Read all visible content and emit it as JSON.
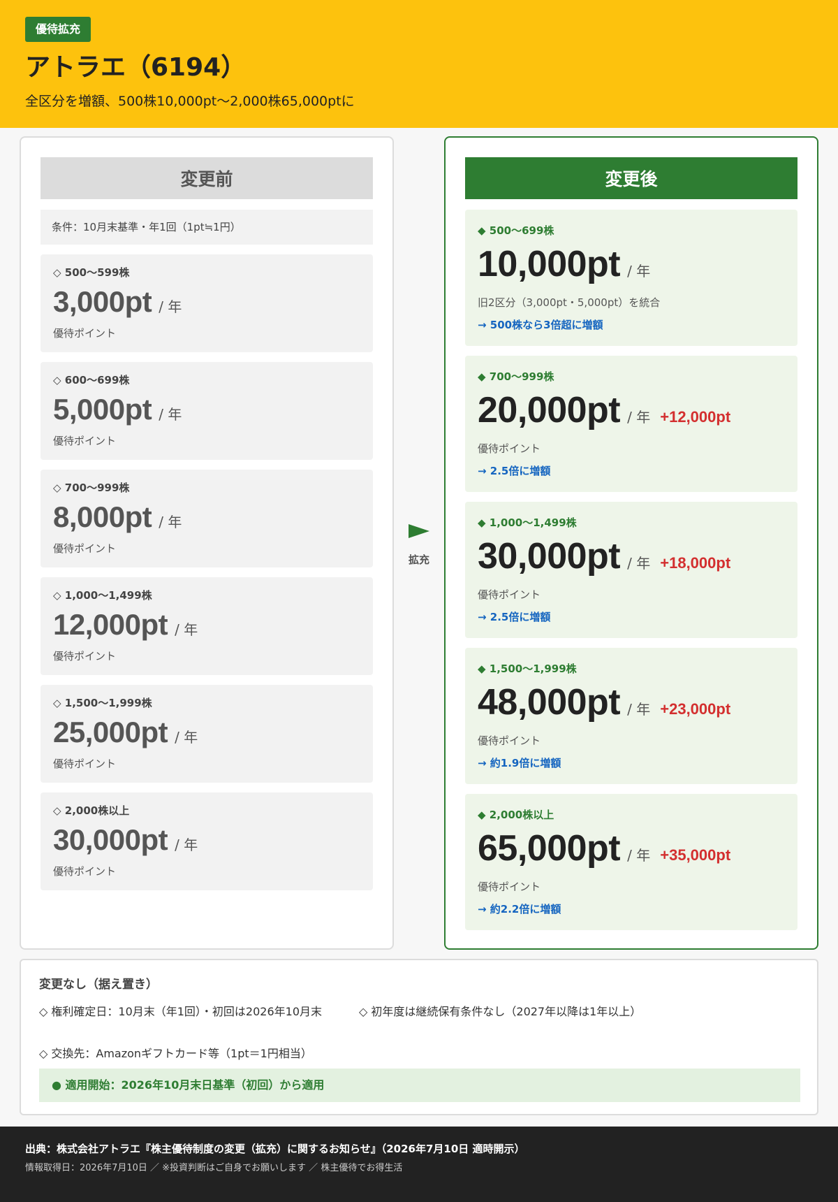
{
  "header": {
    "badge": "優待拡充",
    "title": "アトラエ（6194）",
    "subtitle": "全区分を増額、500株10,000pt〜2,000株65,000ptに"
  },
  "before": {
    "heading": "変更前",
    "condition": "条件：10月末基準・年1回（1pt≒1円）",
    "tiers": [
      {
        "range": "◇ 500〜599株",
        "amount": "3,000pt",
        "per": "/ 年",
        "note": "優待ポイント"
      },
      {
        "range": "◇ 600〜699株",
        "amount": "5,000pt",
        "per": "/ 年",
        "note": "優待ポイント"
      },
      {
        "range": "◇ 700〜999株",
        "amount": "8,000pt",
        "per": "/ 年",
        "note": "優待ポイント"
      },
      {
        "range": "◇ 1,000〜1,499株",
        "amount": "12,000pt",
        "per": "/ 年",
        "note": "優待ポイント"
      },
      {
        "range": "◇ 1,500〜1,999株",
        "amount": "25,000pt",
        "per": "/ 年",
        "note": "優待ポイント"
      },
      {
        "range": "◇ 2,000株以上",
        "amount": "30,000pt",
        "per": "/ 年",
        "note": "優待ポイント"
      }
    ]
  },
  "arrow": {
    "label": "拡充",
    "color": "#2e7d32"
  },
  "after": {
    "heading": "変更後",
    "tiers": [
      {
        "range": "◆ 500〜699株",
        "amount": "10,000pt",
        "per": "/ 年",
        "delta": "",
        "note": "旧2区分（3,000pt・5,000pt）を統合",
        "boost": "→ 500株なら3倍超に増額"
      },
      {
        "range": "◆ 700〜999株",
        "amount": "20,000pt",
        "per": "/ 年",
        "delta": "+12,000pt",
        "note": "優待ポイント",
        "boost": "→ 2.5倍に増額"
      },
      {
        "range": "◆ 1,000〜1,499株",
        "amount": "30,000pt",
        "per": "/ 年",
        "delta": "+18,000pt",
        "note": "優待ポイント",
        "boost": "→ 2.5倍に増額"
      },
      {
        "range": "◆ 1,500〜1,999株",
        "amount": "48,000pt",
        "per": "/ 年",
        "delta": "+23,000pt",
        "note": "優待ポイント",
        "boost": "→ 約1.9倍に増額"
      },
      {
        "range": "◆ 2,000株以上",
        "amount": "65,000pt",
        "per": "/ 年",
        "delta": "+35,000pt",
        "note": "優待ポイント",
        "boost": "→ 約2.2倍に増額"
      }
    ]
  },
  "unchanged": {
    "title": "変更なし（据え置き）",
    "items": [
      "◇ 権利確定日：10月末（年1回）・初回は2026年10月末",
      "◇ 初年度は継続保有条件なし（2027年以降は1年以上）",
      "◇ 交換先：Amazonギフトカード等（1pt＝1円相当）"
    ],
    "apply": "● 適用開始：2026年10月末日基準（初回）から適用"
  },
  "footer": {
    "source": "出典：株式会社アトラエ『株主優待制度の変更（拡充）に関するお知らせ』（2026年7月10日 適時開示）",
    "meta": "情報取得日：2026年7月10日 ／ ※投資判断はご自身でお願いします ／ 株主優待でお得生活"
  }
}
